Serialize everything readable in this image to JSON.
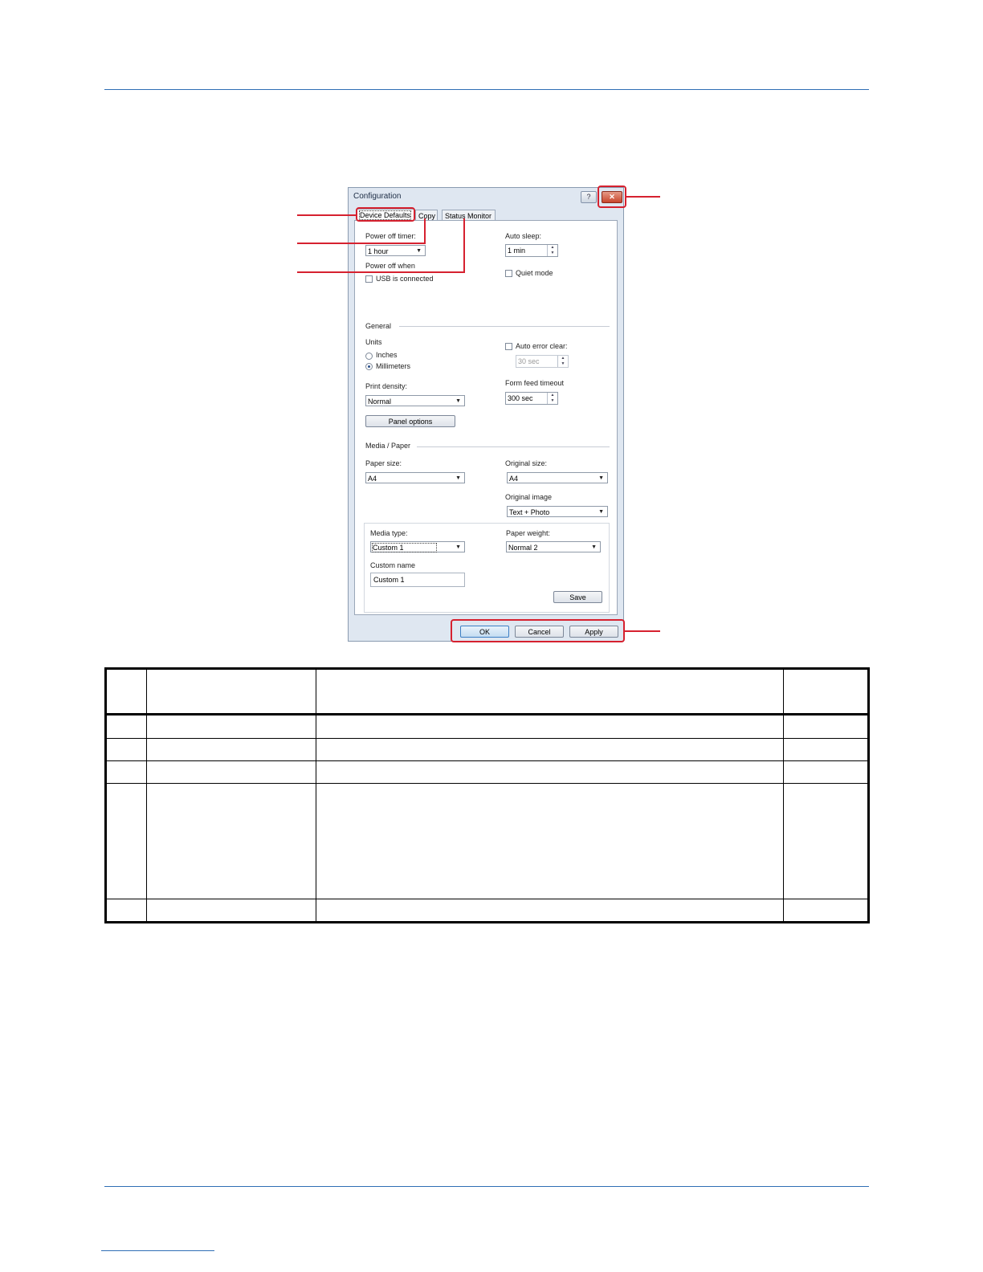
{
  "dialog": {
    "title": "Configuration",
    "help_label": "?",
    "close_label": "✕",
    "tabs": [
      "Device Defaults",
      "Copy",
      "Status Monitor"
    ],
    "device": {
      "power_off_timer_label": "Power off timer:",
      "power_off_timer_value": "1 hour",
      "power_off_when_label": "Power off when",
      "usb_connected_label": "USB is connected",
      "auto_sleep_label": "Auto sleep:",
      "auto_sleep_value": "1 min",
      "quiet_mode_label": "Quiet mode"
    },
    "general": {
      "heading": "General",
      "units_label": "Units",
      "inches_label": "Inches",
      "millimeters_label": "Millimeters",
      "units_selected": "Millimeters",
      "print_density_label": "Print density:",
      "print_density_value": "Normal",
      "panel_options_label": "Panel options",
      "auto_error_clear_label": "Auto error clear:",
      "auto_error_clear_value": "30 sec",
      "form_feed_timeout_label": "Form feed timeout",
      "form_feed_timeout_value": "300 sec"
    },
    "media": {
      "heading": "Media / Paper",
      "paper_size_label": "Paper size:",
      "paper_size_value": "A4",
      "original_size_label": "Original size:",
      "original_size_value": "A4",
      "original_image_label": "Original image",
      "original_image_value": "Text + Photo",
      "media_type_label": "Media type:",
      "media_type_value": "Custom 1",
      "paper_weight_label": "Paper weight:",
      "paper_weight_value": "Normal 2",
      "custom_name_label": "Custom name",
      "custom_name_value": "Custom 1",
      "save_label": "Save"
    },
    "footer_buttons": {
      "ok": "OK",
      "cancel": "Cancel",
      "apply": "Apply"
    }
  },
  "colors": {
    "rule": "#2f6eb5",
    "callout": "#d6212f"
  }
}
